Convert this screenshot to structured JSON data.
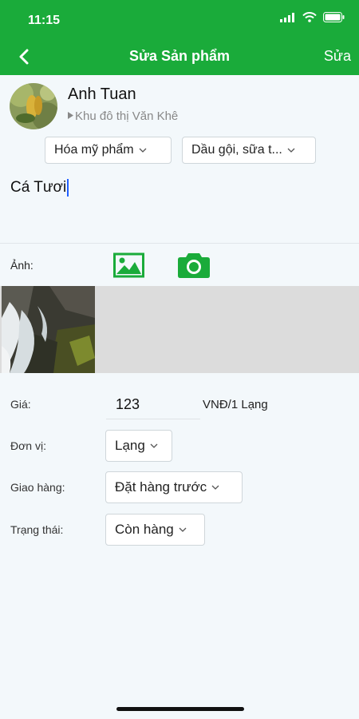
{
  "status_bar": {
    "time": "11:15"
  },
  "nav": {
    "title": "Sửa Sản phẩm",
    "action": "Sửa"
  },
  "user": {
    "name": "Anh Tuan",
    "location": "Khu đô thị Văn Khê"
  },
  "categories": [
    "Hóa mỹ phẩm",
    "Dầu gội, sữa t..."
  ],
  "product": {
    "title": "Cá Tươi"
  },
  "photos": {
    "label": "Ảnh:"
  },
  "form": {
    "price_label": "Giá:",
    "price_value": "123",
    "price_unit": "VNĐ/1 Lạng",
    "unit_label": "Đơn vị:",
    "unit_value": "Lạng",
    "delivery_label": "Giao hàng:",
    "delivery_value": "Đặt hàng trước",
    "status_label": "Trạng thái:",
    "status_value": "Còn hàng"
  },
  "colors": {
    "brand": "#1aab3a",
    "background": "#f3f8fb",
    "photo_strip": "#dcdcdc"
  },
  "icons": [
    "signal-icon",
    "wifi-icon",
    "battery-icon",
    "back-icon",
    "gallery-icon",
    "camera-icon",
    "chevron-down-icon"
  ]
}
